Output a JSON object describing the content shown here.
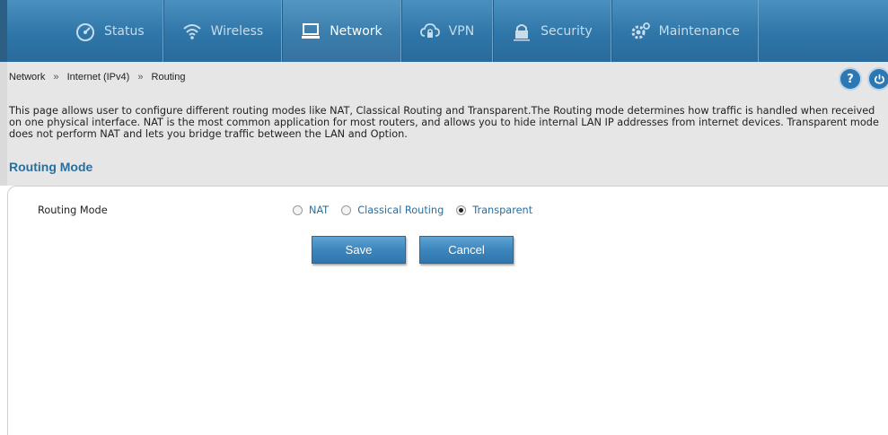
{
  "nav": {
    "items": [
      {
        "label": "Status",
        "icon": "dashboard-icon"
      },
      {
        "label": "Wireless",
        "icon": "wifi-icon"
      },
      {
        "label": "Network",
        "icon": "monitor-icon"
      },
      {
        "label": "VPN",
        "icon": "cloud-lock-icon"
      },
      {
        "label": "Security",
        "icon": "lock-icon"
      },
      {
        "label": "Maintenance",
        "icon": "gears-icon"
      }
    ],
    "active": "Network"
  },
  "breadcrumb": {
    "items": [
      "Network",
      "Internet (IPv4)",
      "Routing"
    ],
    "separator": "»"
  },
  "header_buttons": {
    "help": "?",
    "logout_icon": "power-icon"
  },
  "intro": "This page allows user to configure different routing modes like NAT, Classical Routing and Transparent.The Routing mode determines how traffic is handled when received on one physical interface. NAT is the most common application for most routers, and allows you to hide internal LAN IP addresses from internet devices. Transparent mode does not perform NAT and lets you bridge traffic between the LAN and Option.",
  "section": {
    "title": "Routing Mode"
  },
  "form": {
    "field_label": "Routing Mode",
    "options": [
      "NAT",
      "Classical Routing",
      "Transparent"
    ],
    "selected": "Transparent"
  },
  "buttons": {
    "save": "Save",
    "cancel": "Cancel"
  },
  "colors": {
    "nav_bg": "#2f76a8",
    "accent": "#2a6e9e",
    "content_bg": "#e6e6e6"
  }
}
